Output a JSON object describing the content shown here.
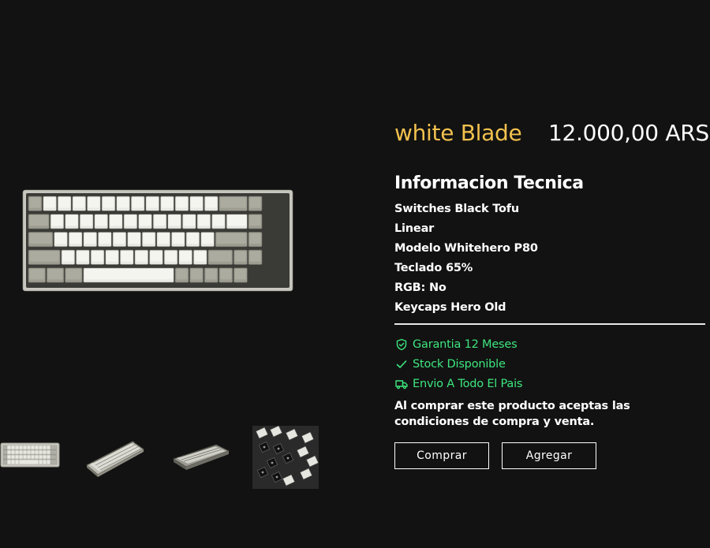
{
  "product": {
    "name": "white Blade",
    "price": "12.000,00 ARS"
  },
  "specs": {
    "title": "Informacion Tecnica",
    "items": [
      "Switches Black Tofu",
      "Linear",
      "Modelo Whitehero P80",
      "Teclado 65%",
      "RGB: No",
      "Keycaps Hero Old"
    ]
  },
  "features": [
    {
      "icon": "shield-check-icon",
      "label": "Garantia  12 Meses"
    },
    {
      "icon": "check-icon",
      "label": "Stock Disponible"
    },
    {
      "icon": "truck-icon",
      "label": "Envio A Todo El Pais"
    }
  ],
  "terms": "Al comprar este producto aceptas las condiciones de compra y venta.",
  "actions": {
    "buy_label": "Comprar",
    "add_label": "Agregar"
  },
  "gallery": {
    "thumbnails": [
      "keyboard-top-view",
      "keyboard-angled-view",
      "keyboard-side-view",
      "keyboard-closeup-view"
    ]
  },
  "colors": {
    "background": "#121212",
    "product_name": "#f2c14e",
    "feature_green": "#3de67e",
    "text": "#ffffff"
  }
}
